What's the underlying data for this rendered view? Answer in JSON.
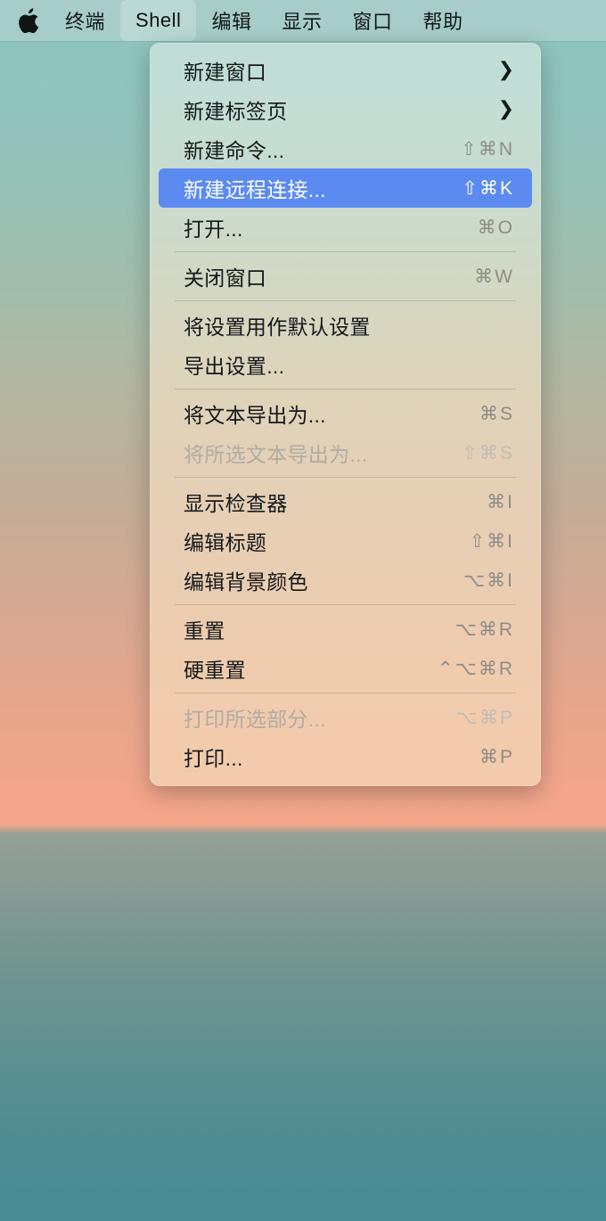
{
  "menubar": {
    "apple_icon": "apple-logo-icon",
    "items": [
      {
        "label": "终端",
        "active": false,
        "name": "menubar-item-terminal"
      },
      {
        "label": "Shell",
        "active": true,
        "name": "menubar-item-shell"
      },
      {
        "label": "编辑",
        "active": false,
        "name": "menubar-item-edit"
      },
      {
        "label": "显示",
        "active": false,
        "name": "menubar-item-view"
      },
      {
        "label": "窗口",
        "active": false,
        "name": "menubar-item-window"
      },
      {
        "label": "帮助",
        "active": false,
        "name": "menubar-item-help"
      }
    ]
  },
  "menu": {
    "title": "Shell",
    "highlight_color": "#5b8bf0",
    "groups": [
      {
        "items": [
          {
            "label": "新建窗口",
            "shortcut": "",
            "submenu": true,
            "disabled": false,
            "selected": false,
            "name": "menu-item-new-window"
          },
          {
            "label": "新建标签页",
            "shortcut": "",
            "submenu": true,
            "disabled": false,
            "selected": false,
            "name": "menu-item-new-tab"
          },
          {
            "label": "新建命令...",
            "shortcut": "⇧⌘N",
            "submenu": false,
            "disabled": false,
            "selected": false,
            "name": "menu-item-new-command"
          },
          {
            "label": "新建远程连接...",
            "shortcut": "⇧⌘K",
            "submenu": false,
            "disabled": false,
            "selected": true,
            "name": "menu-item-new-remote-connection"
          },
          {
            "label": "打开...",
            "shortcut": "⌘O",
            "submenu": false,
            "disabled": false,
            "selected": false,
            "name": "menu-item-open"
          }
        ]
      },
      {
        "items": [
          {
            "label": "关闭窗口",
            "shortcut": "⌘W",
            "submenu": false,
            "disabled": false,
            "selected": false,
            "name": "menu-item-close-window"
          }
        ]
      },
      {
        "items": [
          {
            "label": "将设置用作默认设置",
            "shortcut": "",
            "submenu": false,
            "disabled": false,
            "selected": false,
            "name": "menu-item-use-settings-as-default"
          },
          {
            "label": "导出设置...",
            "shortcut": "",
            "submenu": false,
            "disabled": false,
            "selected": false,
            "name": "menu-item-export-settings"
          }
        ]
      },
      {
        "items": [
          {
            "label": "将文本导出为...",
            "shortcut": "⌘S",
            "submenu": false,
            "disabled": false,
            "selected": false,
            "name": "menu-item-export-text-as"
          },
          {
            "label": "将所选文本导出为...",
            "shortcut": "⇧⌘S",
            "submenu": false,
            "disabled": true,
            "selected": false,
            "name": "menu-item-export-selected-text-as"
          }
        ]
      },
      {
        "items": [
          {
            "label": "显示检查器",
            "shortcut": "⌘I",
            "submenu": false,
            "disabled": false,
            "selected": false,
            "name": "menu-item-show-inspector"
          },
          {
            "label": "编辑标题",
            "shortcut": "⇧⌘I",
            "submenu": false,
            "disabled": false,
            "selected": false,
            "name": "menu-item-edit-title"
          },
          {
            "label": "编辑背景颜色",
            "shortcut": "⌥⌘I",
            "submenu": false,
            "disabled": false,
            "selected": false,
            "name": "menu-item-edit-background-color"
          }
        ]
      },
      {
        "items": [
          {
            "label": "重置",
            "shortcut": "⌥⌘R",
            "submenu": false,
            "disabled": false,
            "selected": false,
            "name": "menu-item-reset"
          },
          {
            "label": "硬重置",
            "shortcut": "⌃⌥⌘R",
            "submenu": false,
            "disabled": false,
            "selected": false,
            "name": "menu-item-hard-reset"
          }
        ]
      },
      {
        "items": [
          {
            "label": "打印所选部分...",
            "shortcut": "⌥⌘P",
            "submenu": false,
            "disabled": true,
            "selected": false,
            "name": "menu-item-print-selection"
          },
          {
            "label": "打印...",
            "shortcut": "⌘P",
            "submenu": false,
            "disabled": false,
            "selected": false,
            "name": "menu-item-print"
          }
        ]
      }
    ]
  }
}
